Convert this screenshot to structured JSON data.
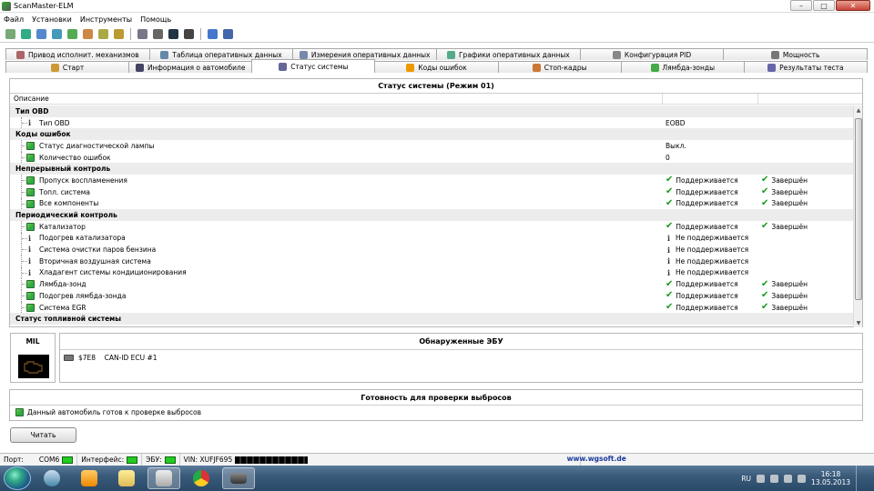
{
  "window": {
    "title": "ScanMaster-ELM",
    "minimize_glyph": "–",
    "maximize_glyph": "□",
    "close_glyph": "✕"
  },
  "menu": [
    "Файл",
    "Установки",
    "Инструменты",
    "Помощь"
  ],
  "toolbar_icons": [
    "connect-icon",
    "globe-icon",
    "scan-icon",
    "table-icon",
    "grid-icon",
    "chart-icon",
    "fuel-icon",
    "money-icon",
    "report-icon",
    "monitor-icon",
    "record-icon",
    "stop-icon",
    "info-icon",
    "book-icon"
  ],
  "tabs_top": [
    {
      "label": "Привод исполнит. механизмов",
      "icon": "actuator-icon"
    },
    {
      "label": "Таблица оперативных данных",
      "icon": "table-icon"
    },
    {
      "label": "Измерения оперативных данных",
      "icon": "gauge-icon"
    },
    {
      "label": "Графики оперативных данных",
      "icon": "chart-icon"
    },
    {
      "label": "Конфигурация PID",
      "icon": "config-icon"
    },
    {
      "label": "Мощность",
      "icon": "power-icon"
    }
  ],
  "tabs_bottom": [
    {
      "label": "Старт",
      "icon": "start-icon"
    },
    {
      "label": "Информация о автомобиле",
      "icon": "info-icon"
    },
    {
      "label": "Статус системы",
      "icon": "status-icon",
      "active": true
    },
    {
      "label": "Коды ошибок",
      "icon": "warning-icon"
    },
    {
      "label": "Стоп-кадры",
      "icon": "freeze-frame-icon"
    },
    {
      "label": "Лямбда-зонды",
      "icon": "lambda-icon"
    },
    {
      "label": "Результаты теста",
      "icon": "test-result-icon"
    }
  ],
  "status_panel": {
    "title": "Статус системы (Режим 01)",
    "column_header": "Описание"
  },
  "rows": [
    {
      "kind": "section",
      "label": "Тип OBD"
    },
    {
      "kind": "item",
      "icon": "info",
      "label": "Тип OBD",
      "value": "EOBD",
      "value_icon": "",
      "status": ""
    },
    {
      "kind": "section",
      "label": "Коды ошибок"
    },
    {
      "kind": "item",
      "icon": "green",
      "label": "Статус диагностической лампы",
      "value": "Выкл.",
      "value_icon": "",
      "status": ""
    },
    {
      "kind": "item",
      "icon": "green",
      "label": "Количество ошибок",
      "value": "0",
      "value_icon": "",
      "status": ""
    },
    {
      "kind": "section",
      "label": "Непрерывный контроль"
    },
    {
      "kind": "item",
      "icon": "green",
      "label": "Пропуск воспламенения",
      "value": "Поддерживается",
      "value_icon": "ok",
      "status": "Завершён"
    },
    {
      "kind": "item",
      "icon": "green",
      "label": "Топл. система",
      "value": "Поддерживается",
      "value_icon": "ok",
      "status": "Завершён"
    },
    {
      "kind": "item",
      "icon": "green",
      "label": "Все компоненты",
      "value": "Поддерживается",
      "value_icon": "ok",
      "status": "Завершён"
    },
    {
      "kind": "section",
      "label": "Периодический контроль"
    },
    {
      "kind": "item",
      "icon": "green",
      "label": "Катализатор",
      "value": "Поддерживается",
      "value_icon": "ok",
      "status": "Завершён"
    },
    {
      "kind": "item",
      "icon": "info",
      "label": "Подогрев катализатора",
      "value": "Не поддерживается",
      "value_icon": "info",
      "status": ""
    },
    {
      "kind": "item",
      "icon": "info",
      "label": "Система очистки паров бензина",
      "value": "Не поддерживается",
      "value_icon": "info",
      "status": ""
    },
    {
      "kind": "item",
      "icon": "info",
      "label": "Вторичная воздушная система",
      "value": "Не поддерживается",
      "value_icon": "info",
      "status": ""
    },
    {
      "kind": "item",
      "icon": "info",
      "label": "Хладагент системы кондиционирования",
      "value": "Не поддерживается",
      "value_icon": "info",
      "status": ""
    },
    {
      "kind": "item",
      "icon": "green",
      "label": "Лямбда-зонд",
      "value": "Поддерживается",
      "value_icon": "ok",
      "status": "Завершён"
    },
    {
      "kind": "item",
      "icon": "green",
      "label": "Подогрев лямбда-зонда",
      "value": "Поддерживается",
      "value_icon": "ok",
      "status": "Завершён"
    },
    {
      "kind": "item",
      "icon": "green",
      "label": "Система EGR",
      "value": "Поддерживается",
      "value_icon": "ok",
      "status": "Завершён"
    },
    {
      "kind": "section",
      "label": "Статус топливной системы"
    }
  ],
  "mil": {
    "label": "MIL",
    "state": "off"
  },
  "ecu": {
    "title": "Обнаруженные ЭБУ",
    "items": [
      "$7E8    CAN-ID ECU #1"
    ]
  },
  "readiness": {
    "title": "Готовность для проверки выбросов",
    "message": "Данный автомобиль готов к проверке выбросов"
  },
  "read_button": "Читать",
  "statusbar": {
    "port_label": "Порт:",
    "port_value": "COM6",
    "interface_label": "Интерфейс:",
    "ecu_label": "ЭБУ:",
    "vin_label": "VIN: XUFJF695",
    "url": "www.wgsoft.de"
  },
  "taskbar": {
    "apps": [
      "explorer-icon",
      "media-player-icon",
      "folder-icon",
      "hp-icon",
      "chrome-icon",
      "scanmaster-icon"
    ],
    "lang": "RU",
    "time": "16:18",
    "date": "13.05.2013"
  },
  "colors": {
    "ok": "#1a9a1a",
    "accent": "#1a3a9a",
    "led": "#22cc22"
  }
}
